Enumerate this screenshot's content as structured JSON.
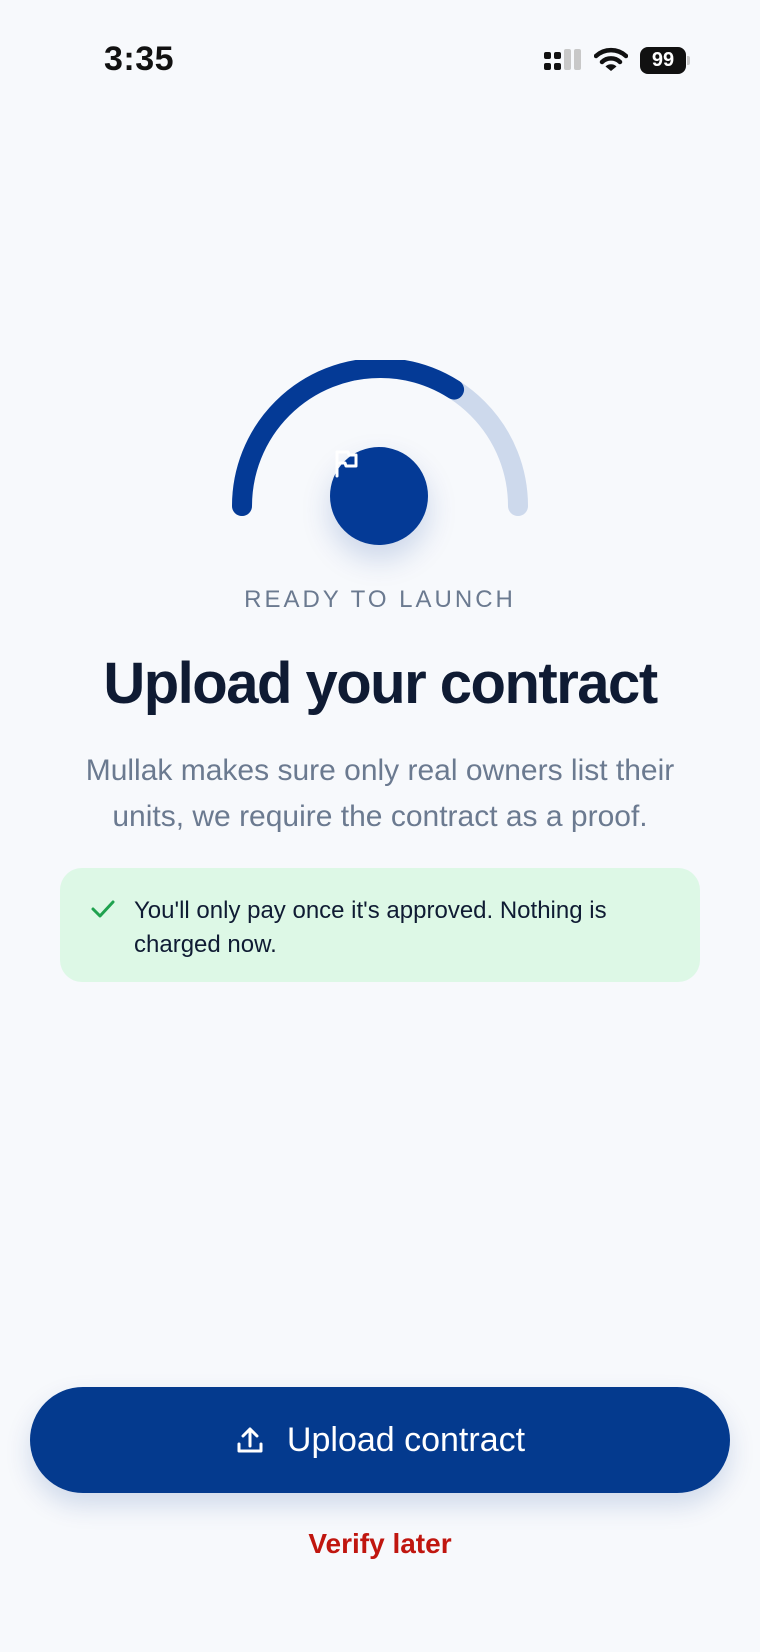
{
  "status_bar": {
    "time": "3:35",
    "battery_level": "99",
    "icons": [
      "signal-icon",
      "wifi-icon",
      "battery-icon"
    ]
  },
  "hero": {
    "progress": 0.68,
    "icon": "flag-icon",
    "eyebrow": "READY TO LAUNCH",
    "title": "Upload your contract",
    "subtitle": "Mullak makes sure only real owners list their units, we require the contract as a proof."
  },
  "notice": {
    "icon": "check-icon",
    "text": "You'll only pay once it's approved. Nothing is charged now."
  },
  "actions": {
    "upload_icon": "upload-icon",
    "upload_label": "Upload contract",
    "verify_later_label": "Verify later"
  },
  "colors": {
    "accent": "#043a8e",
    "track": "#cdd9ec",
    "notice_bg": "#ddf8e6",
    "check": "#1fa24f",
    "danger_link": "#c0160f",
    "background": "#f7f9fc"
  }
}
